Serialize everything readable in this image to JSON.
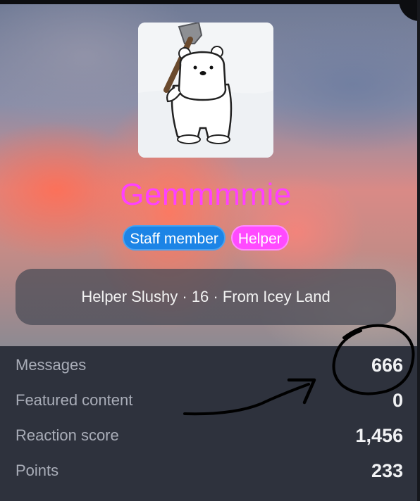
{
  "profile": {
    "username": "Gemmmmie",
    "username_color": "#ff40ff",
    "avatar_icon": "polar-bear-with-axe",
    "badges": [
      {
        "label": "Staff member",
        "color": "#1c84e6"
      },
      {
        "label": "Helper",
        "color": "#ff4aff"
      }
    ],
    "blurb": "Helper Slushy · 16 · From Icey Land"
  },
  "stats": [
    {
      "label": "Messages",
      "value": "666"
    },
    {
      "label": "Featured content",
      "value": "0"
    },
    {
      "label": "Reaction score",
      "value": "1,456"
    },
    {
      "label": "Points",
      "value": "233"
    }
  ],
  "annotation": {
    "type": "hand-drawn circle and arrow pointing at Messages value",
    "color": "#000000"
  }
}
